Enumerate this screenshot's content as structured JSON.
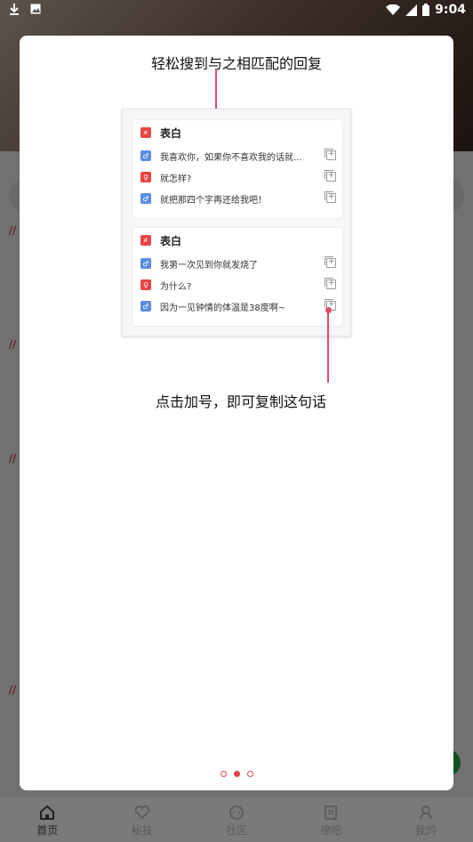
{
  "status_bar": {
    "time": "9:04"
  },
  "modal": {
    "title": "轻松搜到与之相匹配的回复",
    "hint": "点击加号，即可复制这句话",
    "cards": [
      {
        "title": "表白",
        "rows": [
          {
            "gender": "male",
            "text": "我喜欢你，如果你不喜欢我的话就..."
          },
          {
            "gender": "female",
            "text": "就怎样?"
          },
          {
            "gender": "male",
            "text": "就把那四个字再还给我吧！"
          }
        ]
      },
      {
        "title": "表白",
        "rows": [
          {
            "gender": "male",
            "text": "我第一次见到你就发烧了"
          },
          {
            "gender": "female",
            "text": "为什么?"
          },
          {
            "gender": "male",
            "text": "因为一见钟情的体温是38度啊~"
          }
        ]
      }
    ],
    "pager": {
      "count": 3,
      "active_index": 1
    }
  },
  "tab_bar": {
    "tabs": [
      {
        "label": "首页",
        "icon": "home-icon",
        "active": true
      },
      {
        "label": "秘技",
        "icon": "heart-icon",
        "active": false
      },
      {
        "label": "社区",
        "icon": "chat-icon",
        "active": false
      },
      {
        "label": "撩吧",
        "icon": "book-icon",
        "active": false
      },
      {
        "label": "我的",
        "icon": "person-icon",
        "active": false
      }
    ]
  },
  "colors": {
    "accent": "#e24a6b",
    "female_badge": "#e84545",
    "male_badge": "#5b8de6"
  }
}
